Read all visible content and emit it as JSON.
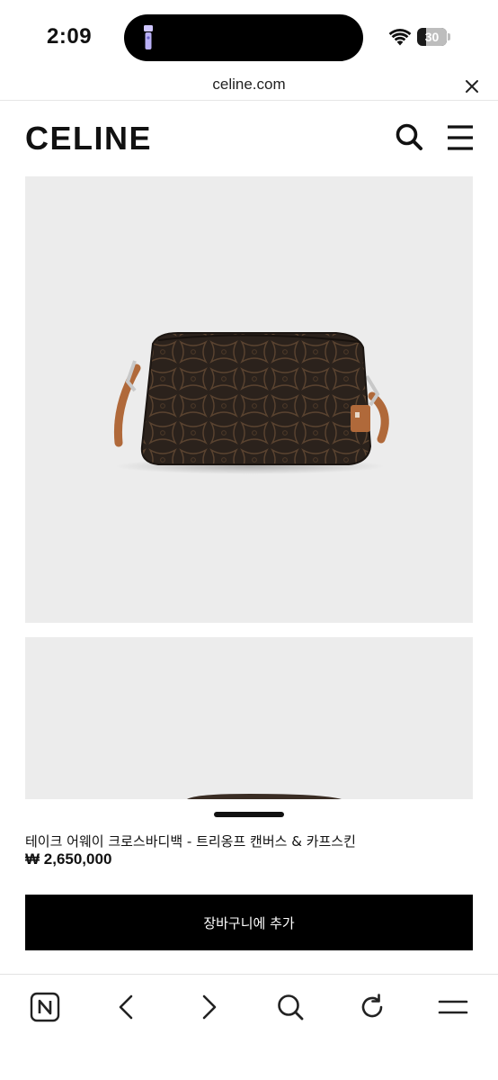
{
  "status_bar": {
    "time": "2:09",
    "battery": "30",
    "battery_level": 0.3
  },
  "browser": {
    "url": "celine.com",
    "close_icon": "close-icon",
    "toolbar_icons": [
      "naver-n-icon",
      "back-arrow-icon",
      "forward-arrow-icon",
      "search-icon",
      "reload-icon",
      "menu-icon"
    ]
  },
  "header": {
    "logo": "CELINE",
    "search_icon": "search-icon",
    "menu_icon": "hamburger-menu-icon"
  },
  "product": {
    "name": "테이크 어웨이 크로스바디백 - 트리옹프 캔버스 & 카프스킨",
    "price": "₩ 2,650,000",
    "add_to_cart": "장바구니에 추가"
  },
  "colors": {
    "image_background": "#ececec",
    "bag_canvas": "#2b221c",
    "bag_leather": "#b0693a",
    "button_bg": "#000000"
  }
}
